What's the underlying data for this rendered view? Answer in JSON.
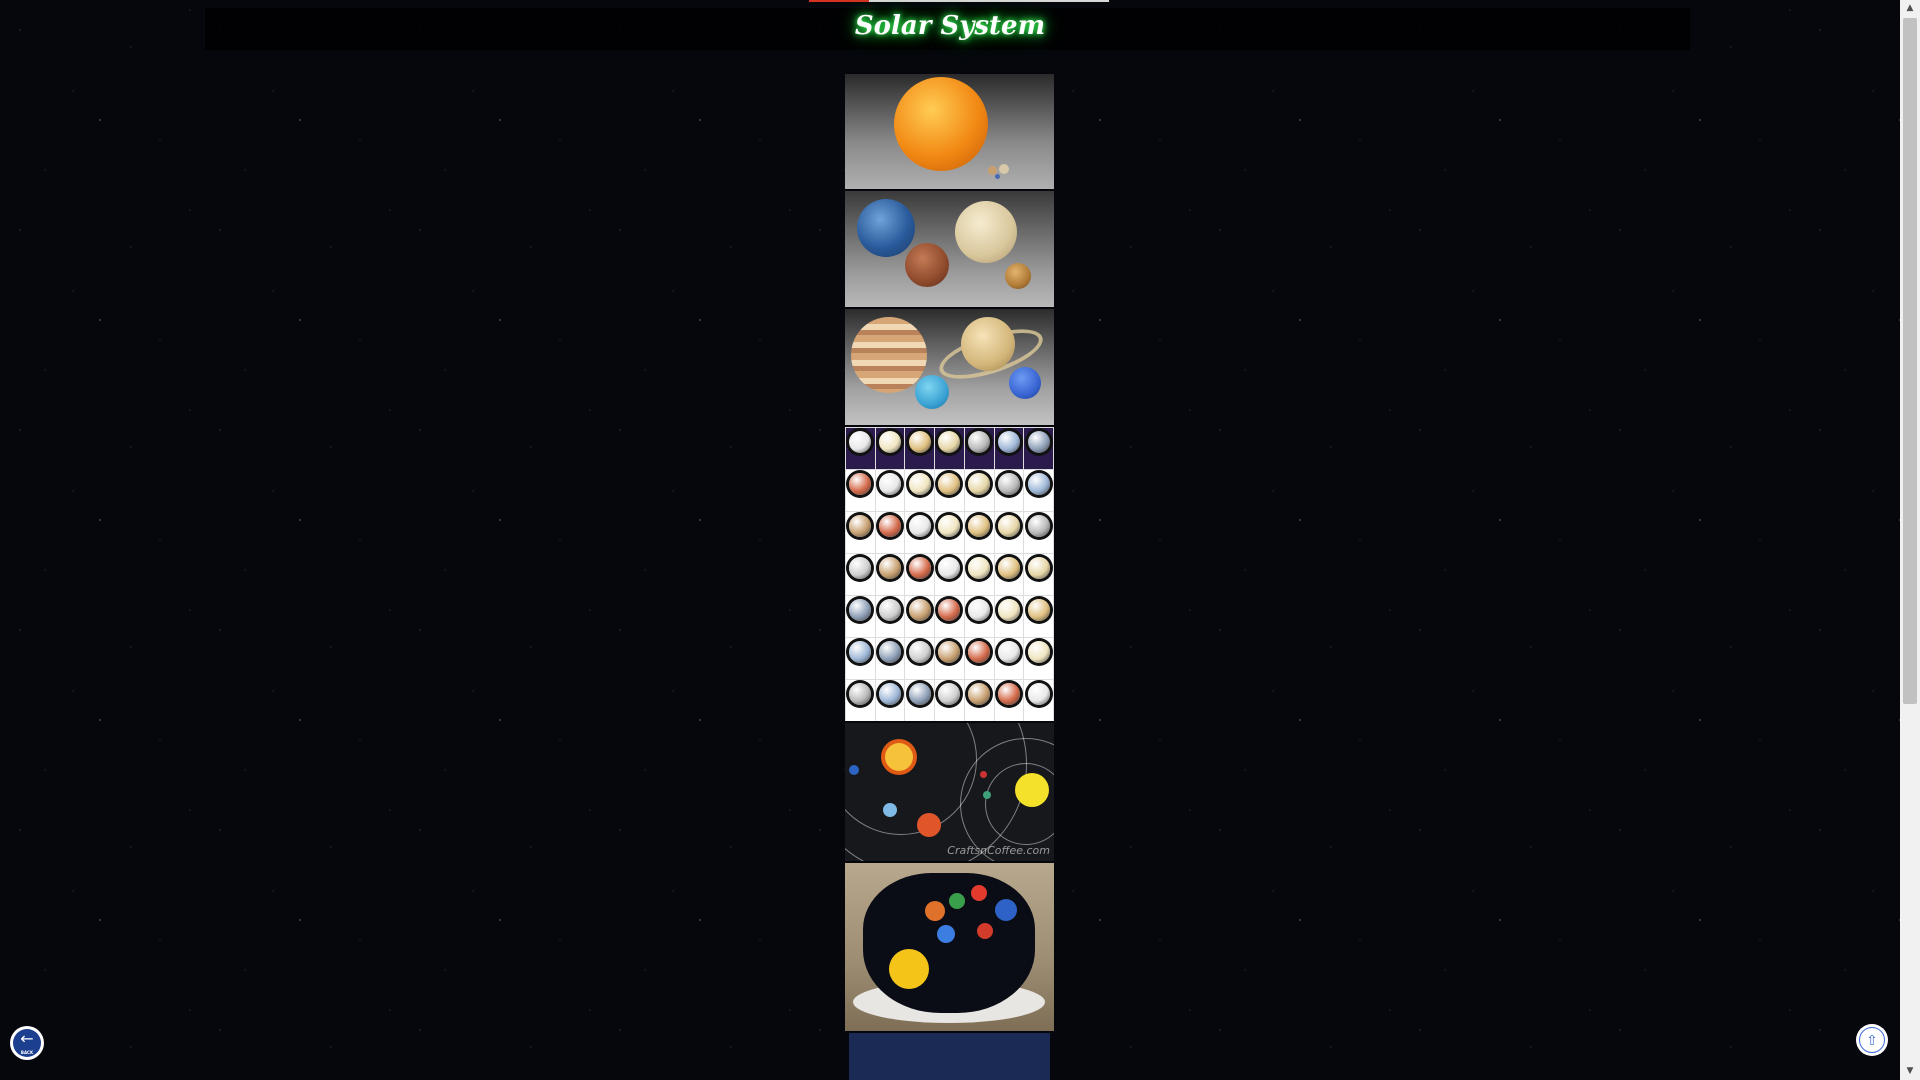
{
  "page": {
    "title": "Solar System",
    "progress_fraction": 0.2
  },
  "images": [
    {
      "name": "sun-comparison"
    },
    {
      "name": "inner-planets"
    },
    {
      "name": "outer-planets"
    },
    {
      "name": "moons-grid"
    },
    {
      "name": "solar-system-model",
      "watermark": "CraftsnCoffee.com"
    },
    {
      "name": "solar-system-cake"
    },
    {
      "name": "partial-next-image"
    }
  ],
  "buttons": {
    "back_label": "BACK",
    "back_icon": "arrow-left-icon",
    "top_icon": "arrow-up-icon"
  },
  "colors": {
    "title_glow": "#3cff5a",
    "progress": "#d5331f",
    "button_blue": "#1c3f8f"
  }
}
